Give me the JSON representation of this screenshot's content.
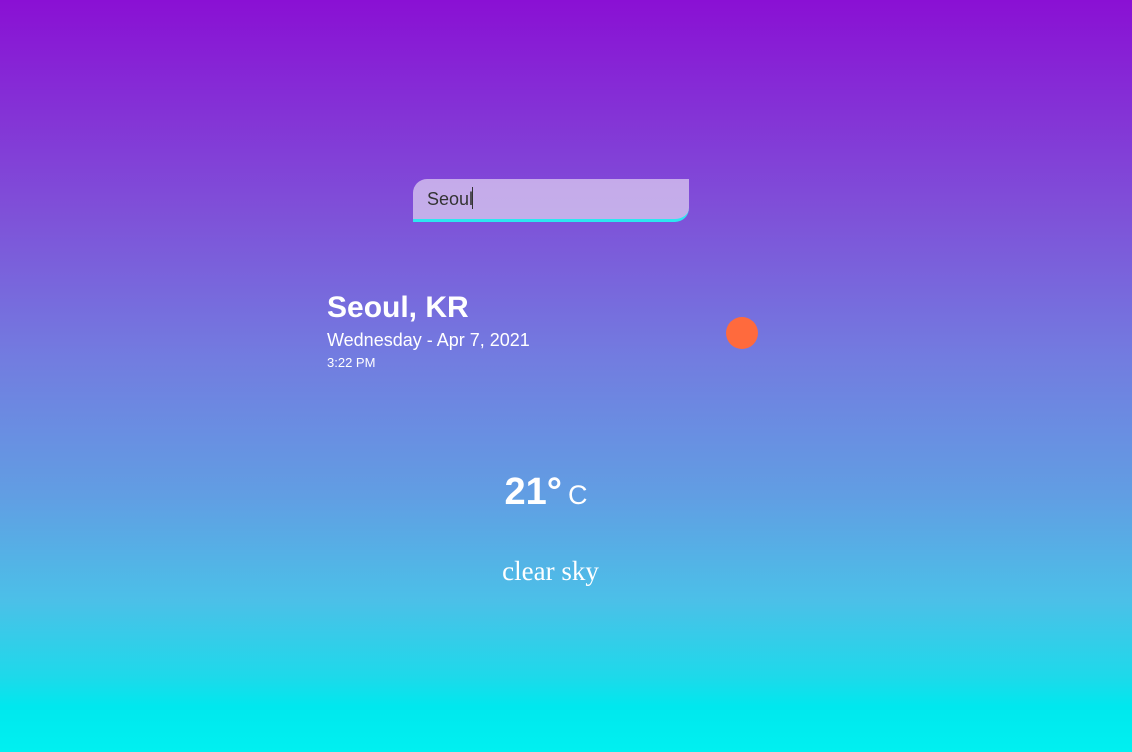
{
  "search": {
    "value": "Seoul"
  },
  "location": {
    "name": "Seoul, KR",
    "date": "Wednesday - Apr 7, 2021",
    "time": "3:22 PM"
  },
  "weather": {
    "icon": "sun-icon",
    "temperature": "21°",
    "unit": "C",
    "description": "clear sky"
  },
  "colors": {
    "gradient_top": "#8a10d4",
    "gradient_bottom": "#00f0f0",
    "sun": "#ff6a3d",
    "search_underline": "#2ee6f0"
  }
}
